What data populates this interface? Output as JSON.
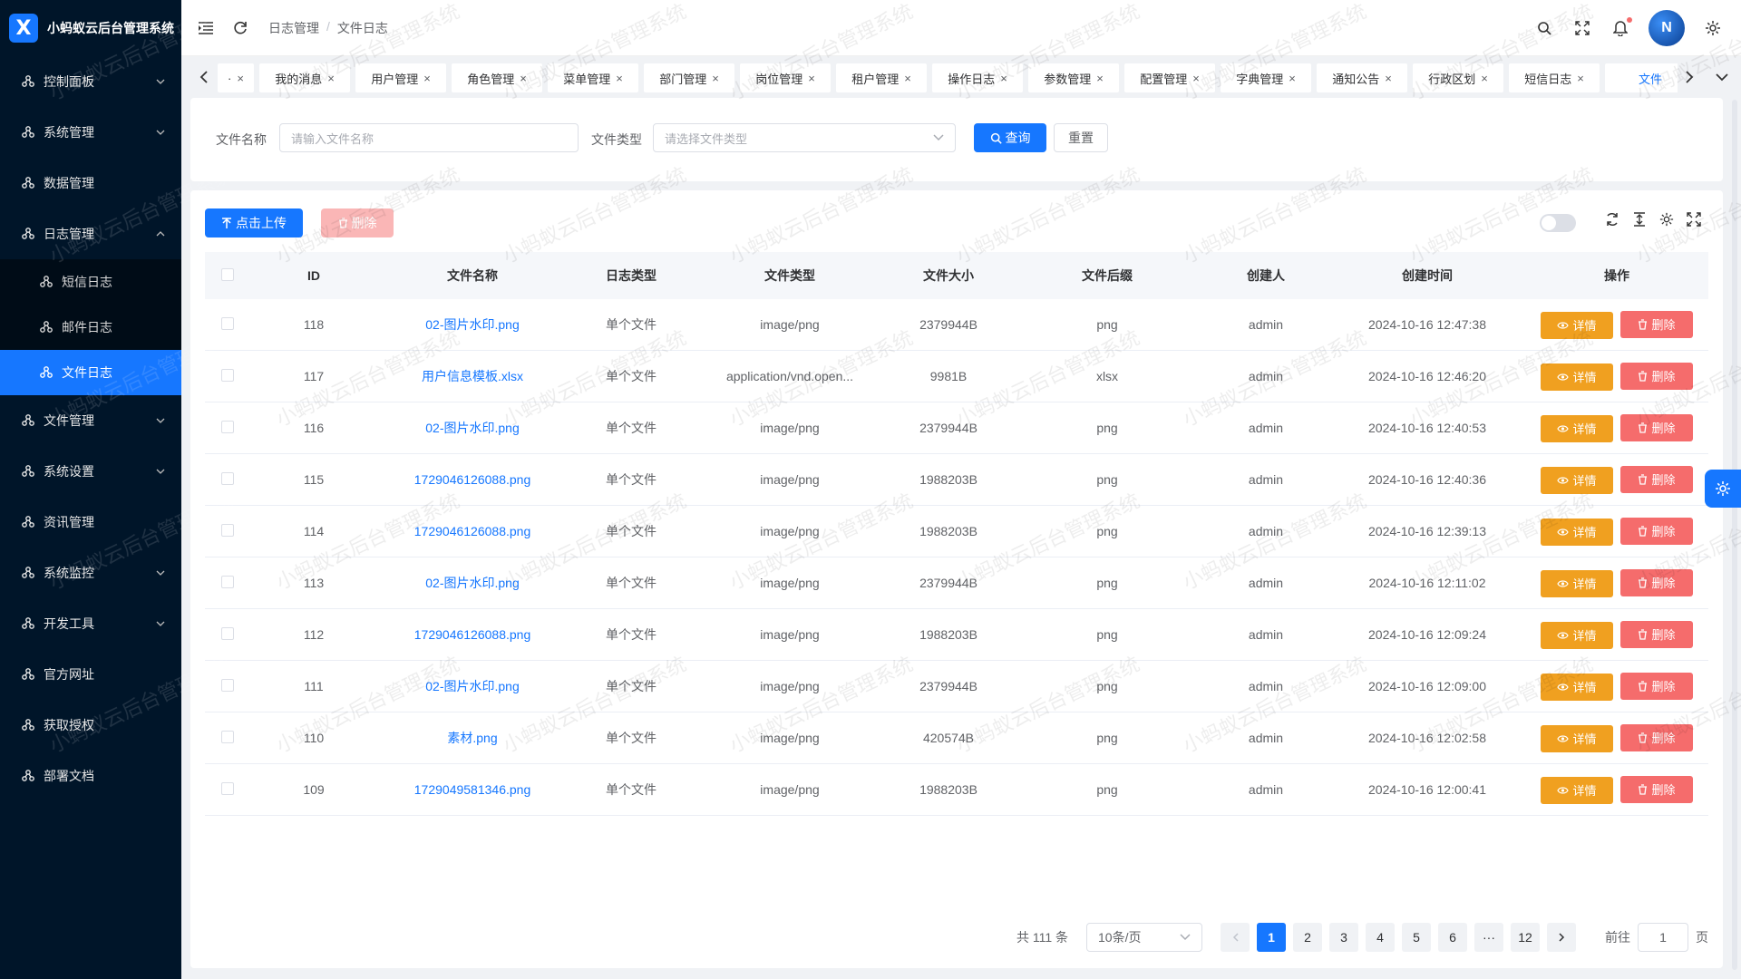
{
  "app": {
    "title": "小蚂蚁云后台管理系统",
    "logo_letter": "X",
    "watermark": "小蚂蚁云后台管理系统",
    "accent": "#1677ff"
  },
  "sidebar": {
    "items": [
      {
        "label": "控制面板",
        "has_arrow": true
      },
      {
        "label": "系统管理",
        "has_arrow": true
      },
      {
        "label": "数据管理",
        "has_arrow": false
      },
      {
        "label": "日志管理",
        "has_arrow": true,
        "expanded": true
      },
      {
        "label": "短信日志",
        "sub": true
      },
      {
        "label": "邮件日志",
        "sub": true
      },
      {
        "label": "文件日志",
        "sub": true,
        "active": true
      },
      {
        "label": "文件管理",
        "has_arrow": true
      },
      {
        "label": "系统设置",
        "has_arrow": true
      },
      {
        "label": "资讯管理",
        "has_arrow": false
      },
      {
        "label": "系统监控",
        "has_arrow": true
      },
      {
        "label": "开发工具",
        "has_arrow": true
      },
      {
        "label": "官方网址",
        "has_arrow": false
      },
      {
        "label": "获取授权",
        "has_arrow": false
      },
      {
        "label": "部署文档",
        "has_arrow": false
      }
    ]
  },
  "breadcrumb": {
    "parent": "日志管理",
    "separator": "/",
    "current": "文件日志"
  },
  "avatar_text": "N",
  "tabs": [
    {
      "label": "·"
    },
    {
      "label": "我的消息"
    },
    {
      "label": "用户管理"
    },
    {
      "label": "角色管理"
    },
    {
      "label": "菜单管理"
    },
    {
      "label": "部门管理"
    },
    {
      "label": "岗位管理"
    },
    {
      "label": "租户管理"
    },
    {
      "label": "操作日志"
    },
    {
      "label": "参数管理"
    },
    {
      "label": "配置管理"
    },
    {
      "label": "字典管理"
    },
    {
      "label": "通知公告"
    },
    {
      "label": "行政区划"
    },
    {
      "label": "短信日志"
    },
    {
      "label": "文件",
      "active": true
    }
  ],
  "tab_close": "×",
  "search": {
    "name_label": "文件名称",
    "name_placeholder": "请输入文件名称",
    "type_label": "文件类型",
    "type_placeholder": "请选择文件类型",
    "query_label": "查询",
    "reset_label": "重置"
  },
  "toolbar": {
    "upload_label": "点击上传",
    "delete_label": "删除"
  },
  "table": {
    "headers": [
      "ID",
      "文件名称",
      "日志类型",
      "文件类型",
      "文件大小",
      "文件后缀",
      "创建人",
      "创建时间",
      "操作"
    ],
    "detail_label": "详情",
    "delete_label": "删除",
    "rows": [
      {
        "id": "118",
        "name": "02-图片水印.png",
        "log_type": "单个文件",
        "file_type": "image/png",
        "size": "2379944B",
        "ext": "png",
        "creator": "admin",
        "time": "2024-10-16 12:47:38"
      },
      {
        "id": "117",
        "name": "用户信息模板.xlsx",
        "log_type": "单个文件",
        "file_type": "application/vnd.open...",
        "size": "9981B",
        "ext": "xlsx",
        "creator": "admin",
        "time": "2024-10-16 12:46:20"
      },
      {
        "id": "116",
        "name": "02-图片水印.png",
        "log_type": "单个文件",
        "file_type": "image/png",
        "size": "2379944B",
        "ext": "png",
        "creator": "admin",
        "time": "2024-10-16 12:40:53"
      },
      {
        "id": "115",
        "name": "1729046126088.png",
        "log_type": "单个文件",
        "file_type": "image/png",
        "size": "1988203B",
        "ext": "png",
        "creator": "admin",
        "time": "2024-10-16 12:40:36"
      },
      {
        "id": "114",
        "name": "1729046126088.png",
        "log_type": "单个文件",
        "file_type": "image/png",
        "size": "1988203B",
        "ext": "png",
        "creator": "admin",
        "time": "2024-10-16 12:39:13"
      },
      {
        "id": "113",
        "name": "02-图片水印.png",
        "log_type": "单个文件",
        "file_type": "image/png",
        "size": "2379944B",
        "ext": "png",
        "creator": "admin",
        "time": "2024-10-16 12:11:02"
      },
      {
        "id": "112",
        "name": "1729046126088.png",
        "log_type": "单个文件",
        "file_type": "image/png",
        "size": "1988203B",
        "ext": "png",
        "creator": "admin",
        "time": "2024-10-16 12:09:24"
      },
      {
        "id": "111",
        "name": "02-图片水印.png",
        "log_type": "单个文件",
        "file_type": "image/png",
        "size": "2379944B",
        "ext": "png",
        "creator": "admin",
        "time": "2024-10-16 12:09:00"
      },
      {
        "id": "110",
        "name": "素材.png",
        "log_type": "单个文件",
        "file_type": "image/png",
        "size": "420574B",
        "ext": "png",
        "creator": "admin",
        "time": "2024-10-16 12:02:58"
      },
      {
        "id": "109",
        "name": "1729049581346.png",
        "log_type": "单个文件",
        "file_type": "image/png",
        "size": "1988203B",
        "ext": "png",
        "creator": "admin",
        "time": "2024-10-16 12:00:41"
      }
    ]
  },
  "pagination": {
    "total": "共 111 条",
    "page_size": "10条/页",
    "pages": [
      "1",
      "2",
      "3",
      "4",
      "5",
      "6",
      "···",
      "12"
    ],
    "current": "1",
    "goto_label": "前往",
    "goto_value": "1",
    "page_unit": "页"
  }
}
